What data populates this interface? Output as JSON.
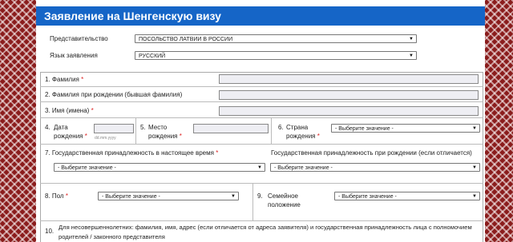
{
  "header": {
    "title": "Заявление на Шенгенскую визу"
  },
  "representation": {
    "label": "Представительство",
    "value": "ПОСОЛЬСТВО ЛАТВИИ В РОССИИ"
  },
  "language": {
    "label": "Язык заявления",
    "value": "РУССКИЙ"
  },
  "fields": {
    "f1": {
      "num": "1.",
      "label": "Фамилия",
      "req": "*"
    },
    "f2": {
      "num": "2.",
      "label": "Фамилия при рождении (бывшая фамилия)"
    },
    "f3": {
      "num": "3.",
      "label": "Имя (имена)",
      "req": "*"
    },
    "f4": {
      "num": "4.",
      "label1": "Дата",
      "label2": "рождения",
      "req": "*",
      "hint": "dd.mm.yyyy"
    },
    "f5": {
      "num": "5.",
      "label1": "Место",
      "label2": "рождения",
      "req": "*"
    },
    "f6": {
      "num": "6.",
      "label1": "Страна",
      "label2": "рождения",
      "req": "*",
      "value": "- Выберите значение -"
    },
    "f7": {
      "num": "7.",
      "label": "Государственная принадлежность в настоящее время",
      "req": "*",
      "value": "- Выберите значение -"
    },
    "f7b": {
      "label": "Государственная принадлежность при рождении (если отличается)",
      "value": "- Выберите значение -"
    },
    "f8": {
      "num": "8.",
      "label": "Пол",
      "req": "*",
      "value": "- Выберите значение -"
    },
    "f9": {
      "num": "9.",
      "label1": "Семейное",
      "label2": "положение",
      "value": "- Выберите значение -"
    },
    "f10": {
      "num": "10.",
      "line1": "Для несовершеннолетних: фамилия, имя, адрес (если отличается от адреса заявителя) и государственная принадлежность лица с полномочием",
      "line2": "родителей / законного представителя"
    }
  }
}
